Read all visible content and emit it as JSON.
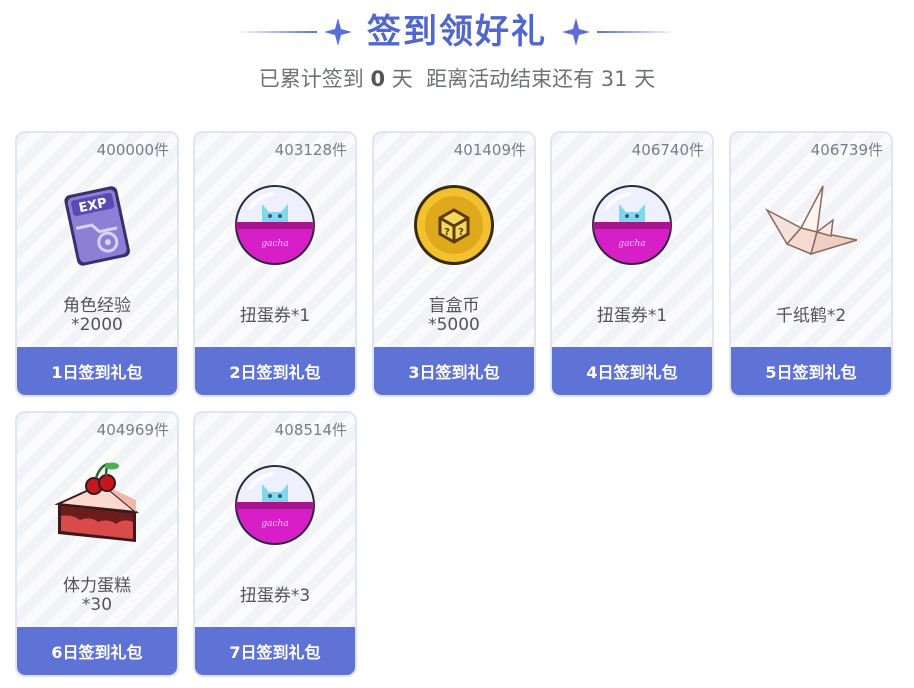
{
  "header": {
    "title": "签到领好礼",
    "subtitle_prefix": "已累计签到 ",
    "signed_days": "0",
    "subtitle_mid": " 天  距离活动结束还有 ",
    "days_left": "31",
    "subtitle_suffix": " 天"
  },
  "colors": {
    "accent": "#5f73d6",
    "title": "#4f67cf",
    "card_border": "#e1e4f3"
  },
  "cards": [
    {
      "count": "400000件",
      "name1": "角色经验",
      "name2": "*2000",
      "button": "1日签到礼包",
      "icon": "exp-card-icon"
    },
    {
      "count": "403128件",
      "name1": "扭蛋券*1",
      "name2": "",
      "button": "2日签到礼包",
      "icon": "gacha-capsule-icon"
    },
    {
      "count": "401409件",
      "name1": "盲盒币",
      "name2": "*5000",
      "button": "3日签到礼包",
      "icon": "blind-box-coin-icon"
    },
    {
      "count": "406740件",
      "name1": "扭蛋券*1",
      "name2": "",
      "button": "4日签到礼包",
      "icon": "gacha-capsule-icon"
    },
    {
      "count": "406739件",
      "name1": "千纸鹤*2",
      "name2": "",
      "button": "5日签到礼包",
      "icon": "paper-crane-icon"
    },
    {
      "count": "404969件",
      "name1": "体力蛋糕",
      "name2": "*30",
      "button": "6日签到礼包",
      "icon": "stamina-cake-icon"
    },
    {
      "count": "408514件",
      "name1": "扭蛋券*3",
      "name2": "",
      "button": "7日签到礼包",
      "icon": "gacha-capsule-icon"
    }
  ]
}
